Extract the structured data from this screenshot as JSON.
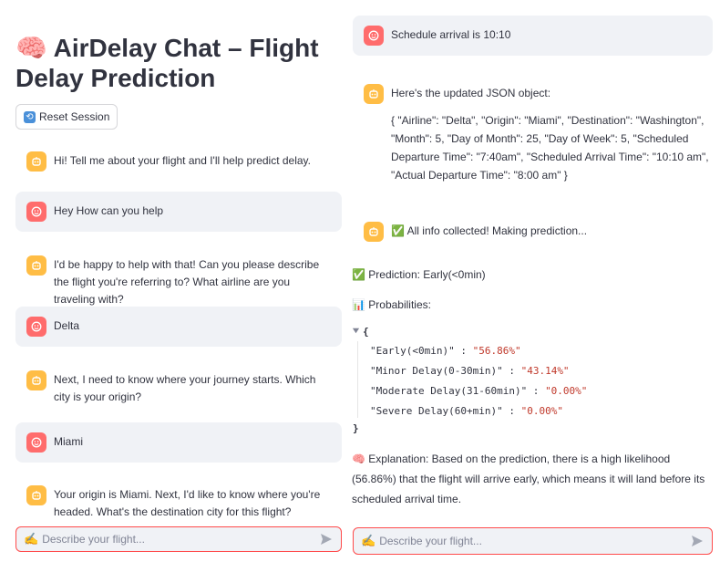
{
  "app": {
    "title": "🧠 AirDelay Chat – Flight Delay Prediction",
    "reset_label": "Reset Session"
  },
  "left_messages": [
    {
      "role": "assistant",
      "text": "Hi! Tell me about your flight and I'll help predict delay."
    },
    {
      "role": "user",
      "text": "Hey How can you help"
    },
    {
      "role": "assistant",
      "text": "I'd be happy to help with that! Can you please describe the flight you're referring to? What airline are you traveling with?"
    },
    {
      "role": "user",
      "text": "Delta"
    },
    {
      "role": "assistant",
      "text": "Next, I need to know where your journey starts. Which city is your origin?"
    },
    {
      "role": "user",
      "text": "Miami"
    },
    {
      "role": "assistant",
      "text": "Your origin is Miami. Next, I'd like to know where you're headed. What's the destination city for this flight?"
    }
  ],
  "right_messages": {
    "user_arrival": "Schedule arrival is 10:10",
    "json_intro": "Here's the updated JSON object:",
    "json_body": "{ \"Airline\": \"Delta\", \"Origin\": \"Miami\", \"Destination\": \"Washington\", \"Month\": 5, \"Day of Month\": 25, \"Day of Week\": 5, \"Scheduled Departure Time\": \"7:40am\", \"Scheduled Arrival Time\": \"10:10 am\", \"Actual Departure Time\": \"8:00 am\" }",
    "collected": "✅ All info collected! Making prediction..."
  },
  "prediction": {
    "label": "✅ Prediction: Early(<0min)",
    "probabilities_label": "📊 Probabilities:",
    "open_brace": "{",
    "close_brace": "}",
    "items": [
      {
        "key": "\"Early(<0min)\"",
        "value": "\"56.86%\""
      },
      {
        "key": "\"Minor Delay(0-30min)\"",
        "value": "\"43.14%\""
      },
      {
        "key": "\"Moderate Delay(31-60min)\"",
        "value": "\"0.00%\""
      },
      {
        "key": "\"Severe Delay(60+min)\"",
        "value": "\"0.00%\""
      }
    ],
    "explanation": "🧠 Explanation: Based on the prediction, there is a high likelihood (56.86%) that the flight will arrive early, which means it will land before its scheduled arrival time."
  },
  "input": {
    "placeholder": "Describe your flight...",
    "pen_icon": "✍️"
  },
  "colors": {
    "assistant_avatar": "#ffbd45",
    "user_avatar": "#ff6c6c",
    "user_bubble": "#f0f2f6",
    "input_border": "#ff4b4b",
    "json_string": "#c0392b"
  },
  "icons": {
    "assistant": "robot-face-icon",
    "user": "smiley-face-icon",
    "send": "send-icon",
    "collapse": "caret-down-icon"
  }
}
